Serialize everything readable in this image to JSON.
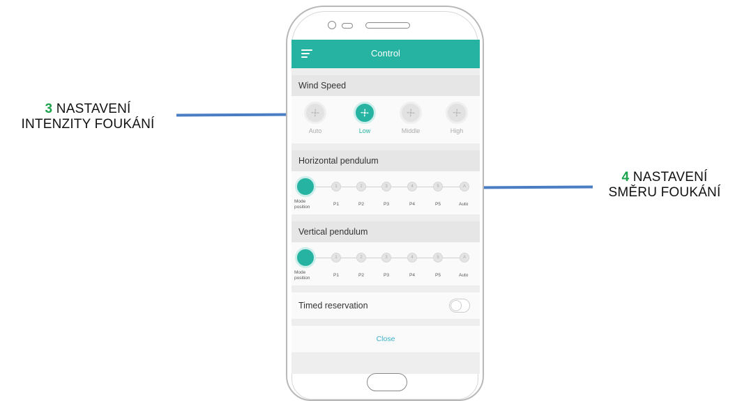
{
  "annotations": {
    "left": {
      "number": "3",
      "line1": "NASTAVENÍ",
      "line2": "INTENZITY FOUKÁNÍ"
    },
    "right": {
      "number": "4",
      "line1": "NASTAVENÍ",
      "line2": "SMĚRU FOUKÁNÍ"
    }
  },
  "appbar": {
    "title": "Control",
    "menu_icon": "hamburger-menu-icon"
  },
  "wind_speed": {
    "title": "Wind Speed",
    "selected": "Low",
    "options": [
      {
        "label": "Auto",
        "icon": "fan-icon"
      },
      {
        "label": "Low",
        "icon": "fan-icon"
      },
      {
        "label": "Middle",
        "icon": "fan-icon"
      },
      {
        "label": "High",
        "icon": "fan-icon"
      }
    ]
  },
  "horizontal": {
    "title": "Horizontal pendulum",
    "nodes": [
      "",
      "1",
      "2",
      "3",
      "4",
      "5",
      "A"
    ],
    "labels": {
      "mode1": "Mode",
      "mode2": "position",
      "p1": "P1",
      "p2": "P2",
      "p3": "P3",
      "p4": "P4",
      "p5": "P5",
      "auto": "Auto"
    }
  },
  "vertical": {
    "title": "Vertical pendulum",
    "nodes": [
      "",
      "1",
      "2",
      "3",
      "4",
      "5",
      "A"
    ],
    "labels": {
      "mode1": "Mode",
      "mode2": "position",
      "p1": "P1",
      "p2": "P2",
      "p3": "P3",
      "p4": "P4",
      "p5": "P5",
      "auto": "Auto"
    }
  },
  "timer": {
    "label": "Timed reservation",
    "enabled": false
  },
  "close_label": "Close",
  "colors": {
    "accent": "#26b3a2",
    "annotation_number": "#1aa34a",
    "leader_line": "#4a7dc4",
    "close_text": "#3ab0c8"
  }
}
